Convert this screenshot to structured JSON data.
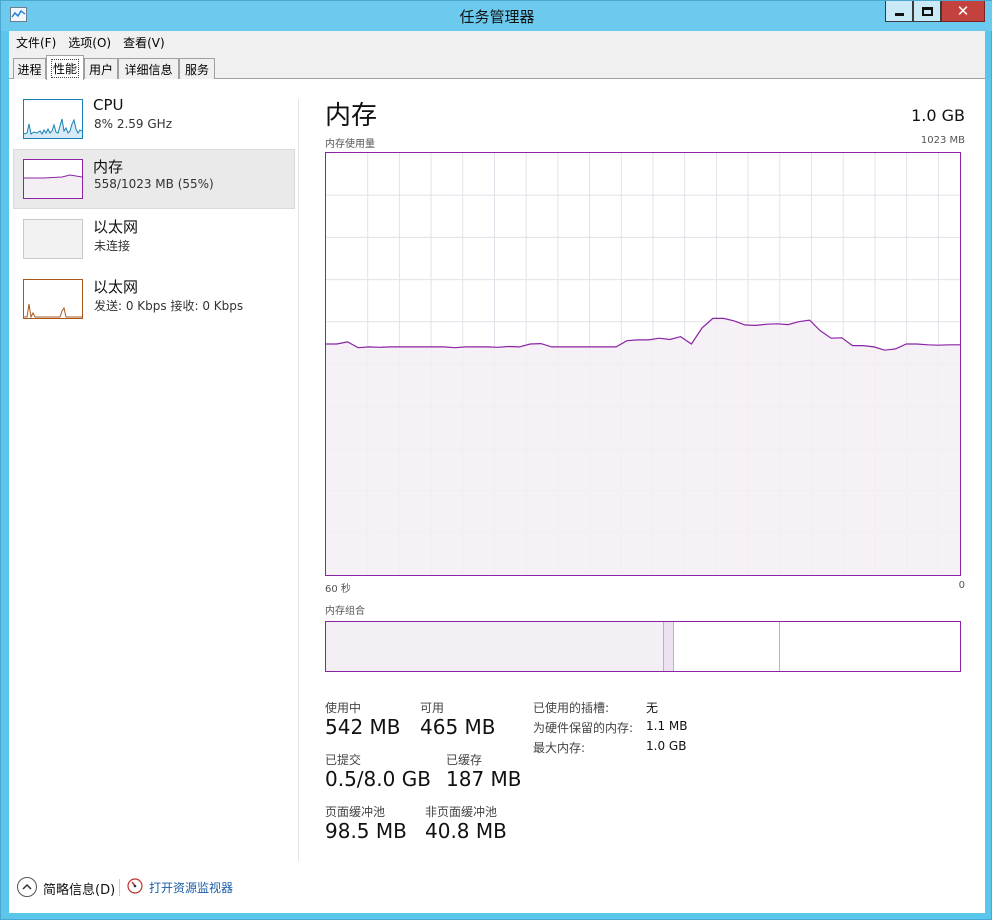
{
  "window": {
    "title": "任务管理器"
  },
  "menu": [
    "文件(F)",
    "选项(O)",
    "查看(V)"
  ],
  "tabs": [
    "进程",
    "性能",
    "用户",
    "详细信息",
    "服务"
  ],
  "active_tab": "性能",
  "sidebar": {
    "items": [
      {
        "name": "CPU",
        "detail": "8% 2.59 GHz"
      },
      {
        "name": "内存",
        "detail": "558/1023 MB (55%)"
      },
      {
        "name": "以太网",
        "detail": "未连接"
      },
      {
        "name": "以太网",
        "detail": "发送: 0 Kbps 接收: 0 Kbps"
      }
    ]
  },
  "main": {
    "title": "内存",
    "total": "1.0 GB",
    "graph_label": "内存使用量",
    "graph_max": "1023 MB",
    "axis_left": "60 秒",
    "axis_right": "0",
    "composition_label": "内存组合"
  },
  "stats": {
    "in_use_label": "使用中",
    "in_use": "542 MB",
    "available_label": "可用",
    "available": "465 MB",
    "committed_label": "已提交",
    "committed": "0.5/8.0 GB",
    "cached_label": "已缓存",
    "cached": "187 MB",
    "paged_label": "页面缓冲池",
    "paged": "98.5 MB",
    "nonpaged_label": "非页面缓冲池",
    "nonpaged": "40.8 MB",
    "slots_label": "已使用的插槽:",
    "slots": "无",
    "reserved_label": "为硬件保留的内存:",
    "reserved": "1.1 MB",
    "max_label": "最大内存:",
    "max": "1.0 GB"
  },
  "footer": {
    "fewer_details": "简略信息(D)",
    "open_monitor": "打开资源监视器"
  },
  "chart_data": {
    "type": "area",
    "title": "内存使用量",
    "xlabel": "",
    "ylabel": "",
    "x_range_seconds": [
      60,
      0
    ],
    "ylim": [
      0,
      1023
    ],
    "series": [
      {
        "values": [
          560,
          560,
          565,
          551,
          553,
          552,
          553,
          553,
          553,
          553,
          553,
          553,
          551,
          553,
          553,
          553,
          552,
          554,
          553,
          560,
          561,
          553,
          553,
          553,
          553,
          553,
          553,
          553,
          568,
          570,
          570,
          574,
          571,
          578,
          560,
          599,
          622,
          622,
          616,
          606,
          605,
          608,
          609,
          607,
          614,
          618,
          592,
          574,
          575,
          556,
          556,
          553,
          545,
          548,
          560,
          560,
          558,
          557,
          558,
          558
        ]
      }
    ],
    "colors": {
      "line": "#8b23a4",
      "fill": "#f3eff5",
      "grid": "#e6e0ea"
    },
    "composition": {
      "in_use_mb": 542,
      "modified_mb": 16,
      "standby_mb": 172,
      "free_mb": 293
    }
  }
}
